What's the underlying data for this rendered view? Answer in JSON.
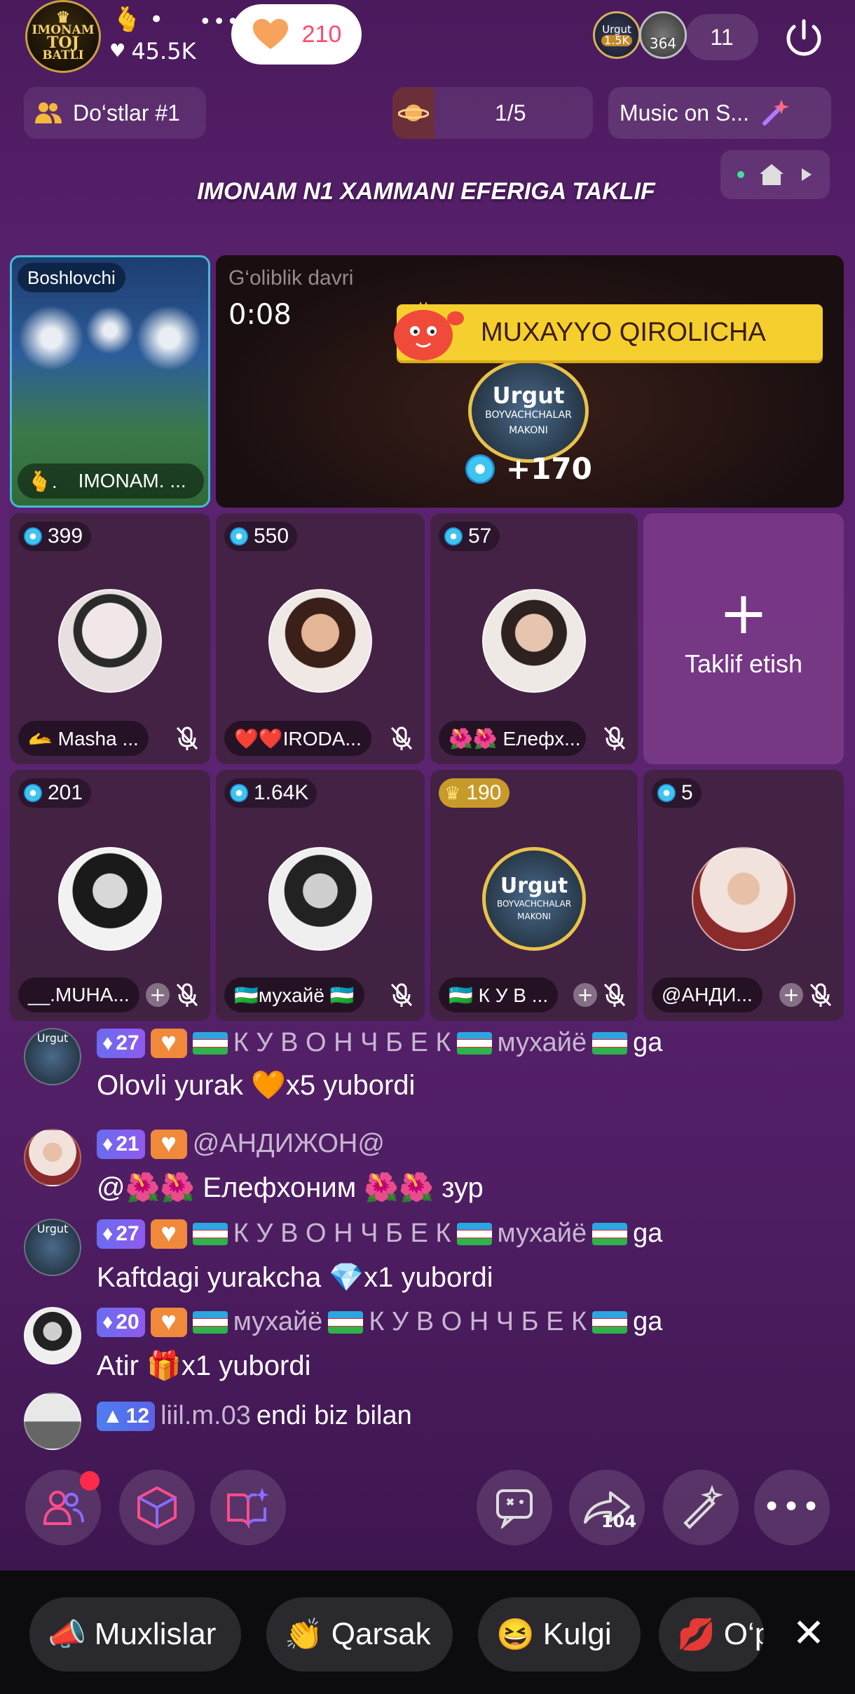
{
  "host": {
    "avatar_text": [
      "IMONAM",
      "TOJ",
      "BATLI"
    ],
    "name_suffix": "•",
    "name_emoji": "🫰",
    "likes": "45.5K",
    "more": "•••",
    "follow_count": "210"
  },
  "viewers": {
    "top1_label": "Urgut",
    "top1_value": "1.5K",
    "top2_value": "364",
    "count": "11"
  },
  "friends_label": "Do‘stlar #1",
  "round": "1/5",
  "music_label": "Music on S...",
  "room_title": "IMONAM N1 XAMMANI EFERIGA TAKLIF",
  "host_seat": {
    "role": "Boshlovchi",
    "name": "IMONAM. ...",
    "name_emoji": "🫰."
  },
  "winner_panel": {
    "label": "G‘oliblik davri",
    "timer": "0:08",
    "banner_name": "MUXAYYO QIROLICHA",
    "avatar_text": [
      "Urgut",
      "BOYVACHCHALAR",
      "MAKONI"
    ],
    "score": "+170"
  },
  "seats_row1": [
    {
      "score": "399",
      "name": "🫴 Masha ...",
      "avatar_color": "#d9d0d6"
    },
    {
      "score": "550",
      "name": "❤️❤️IRODA...",
      "avatar_color": "#c98c6b"
    },
    {
      "score": "57",
      "name": "🌺🌺 Елефх...",
      "avatar_color": "#bfa48f"
    }
  ],
  "invite_label": "Taklif etish",
  "seats_row2": [
    {
      "score": "201",
      "name": "__.MUHA...",
      "avatar_color": "#2b2b2b",
      "score_type": "gem"
    },
    {
      "score": "1.64K",
      "name": "🇺🇿мухайё 🇺🇿",
      "avatar_color": "#3a3a3a",
      "score_type": "gem"
    },
    {
      "score": "190",
      "name": "🇺🇿 К У В ...",
      "avatar_color": "#1b2a44",
      "score_type": "crown"
    },
    {
      "score": "5",
      "name": "@АНДИ...",
      "avatar_color": "#8b3a3a",
      "score_type": "gem"
    }
  ],
  "chat": [
    {
      "level": "27",
      "line1_a": " К У В О Н Ч Б Е К ",
      "line1_b": "мухайё ",
      "line1_c": "ga",
      "line2": "Olovli yurak 🧡x5 yubordi"
    },
    {
      "level": "21",
      "user": "@АНДИЖОН@",
      "line2": "@🌺🌺 Елефхоним 🌺🌺 зур"
    },
    {
      "level": "27",
      "line1_a": " К У В О Н Ч Б Е К ",
      "line1_b": "мухайё ",
      "line1_c": "ga",
      "line2": "Kaftdagi yurakcha 💎x1 yubordi"
    },
    {
      "level": "20",
      "line1_a": "мухайё ",
      "line1_b": " К У В О Н Ч Б Е К ",
      "line1_c": "ga",
      "line2": "Atir 🎁x1 yubordi"
    },
    {
      "level": "12",
      "user": "liil.m.03",
      "line1_c": " endi biz bilan"
    }
  ],
  "toolbar": {
    "share_count": "104"
  },
  "reactions": [
    "Muxlislar",
    "Qarsak",
    "Kulgi",
    "O‘p"
  ]
}
